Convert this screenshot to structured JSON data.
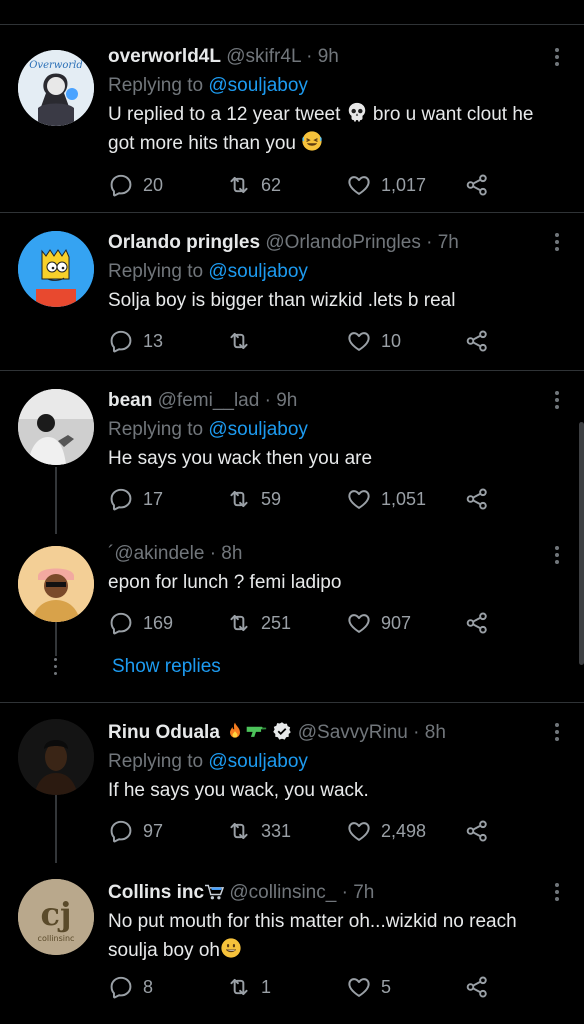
{
  "tweets": [
    {
      "name": "overworld4L",
      "badges": "",
      "handle": "@skifr4L",
      "time": "9h",
      "replying_prefix": "Replying to",
      "replying_to": "@souljaboy",
      "text_lines": [
        "U replied to a 12 year tweet ",
        " bro u want clout he",
        "got more hits than you "
      ],
      "text_emoji": [
        "skull",
        "rolling-laughing"
      ],
      "replies": "20",
      "retweets": "62",
      "likes": "1,017"
    },
    {
      "name": "Orlando pringles",
      "badges": "",
      "handle": "@OrlandoPringles",
      "time": "7h",
      "replying_prefix": "Replying to",
      "replying_to": "@souljaboy",
      "text_lines": [
        "Solja boy is bigger than wizkid .lets b real"
      ],
      "replies": "13",
      "retweets": "",
      "likes": "10"
    },
    {
      "name": "bean",
      "badges": "",
      "handle": "@femi__lad",
      "time": "9h",
      "replying_prefix": "Replying to",
      "replying_to": "@souljaboy",
      "text_lines": [
        "He says you wack then you are"
      ],
      "replies": "17",
      "retweets": "59",
      "likes": "1,051"
    },
    {
      "name": "",
      "badges": "",
      "handle": "´@akindele",
      "time": "8h",
      "replying_prefix": "",
      "replying_to": "",
      "text_lines": [
        "epon for lunch ? femi ladipo"
      ],
      "replies": "169",
      "retweets": "251",
      "likes": "907"
    },
    {
      "name": "Rinu Oduala",
      "badges": "fire, water-pistol, verified",
      "handle": "@SavvyRinu",
      "time": "8h",
      "replying_prefix": "Replying to",
      "replying_to": "@souljaboy",
      "text_lines": [
        "If he says you wack, you wack."
      ],
      "replies": "97",
      "retweets": "331",
      "likes": "2,498"
    },
    {
      "name": "Collins inc",
      "badges": "shopping-cart",
      "handle": "@collinsinc_",
      "time": "7h",
      "replying_prefix": "",
      "replying_to": "",
      "text_lines": [
        "No put mouth for this matter oh...wizkid no reach",
        "soulja boy oh"
      ],
      "text_emoji": [
        "grinning-face"
      ],
      "replies": "8",
      "retweets": "1",
      "likes": "5"
    }
  ],
  "show_replies": "Show replies",
  "dot": "·",
  "colors": {
    "background": "#000000",
    "text": "#e7e9ea",
    "muted": "#71767b",
    "link": "#1d9bf0",
    "divider": "#2f3336"
  },
  "icons": [
    "reply-icon",
    "retweet-icon",
    "like-icon",
    "share-icon",
    "more-icon"
  ]
}
